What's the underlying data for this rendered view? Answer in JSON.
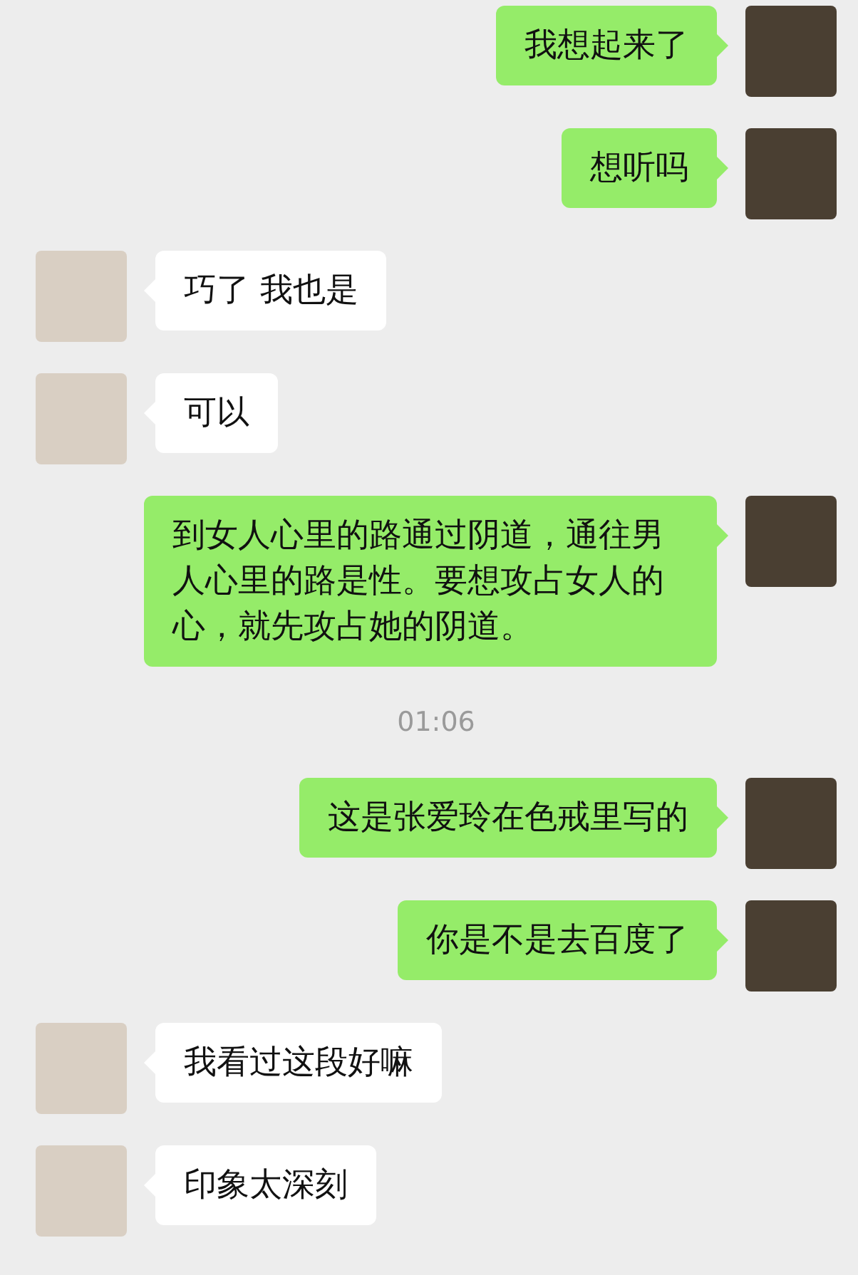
{
  "messages": [
    {
      "kind": "sent",
      "text": "我想起来了"
    },
    {
      "kind": "sent",
      "text": "想听吗"
    },
    {
      "kind": "received",
      "text": "巧了 我也是"
    },
    {
      "kind": "received",
      "text": "可以"
    },
    {
      "kind": "sent",
      "text": "到女人心里的路通过阴道，通往男人心里的路是性。要想攻占女人的心，就先攻占她的阴道。"
    },
    {
      "kind": "time",
      "text": "01:06"
    },
    {
      "kind": "sent",
      "text": "这是张爱玲在色戒里写的"
    },
    {
      "kind": "sent",
      "text": "你是不是去百度了"
    },
    {
      "kind": "received",
      "text": "我看过这段好嘛"
    },
    {
      "kind": "received",
      "text": "印象太深刻"
    }
  ]
}
